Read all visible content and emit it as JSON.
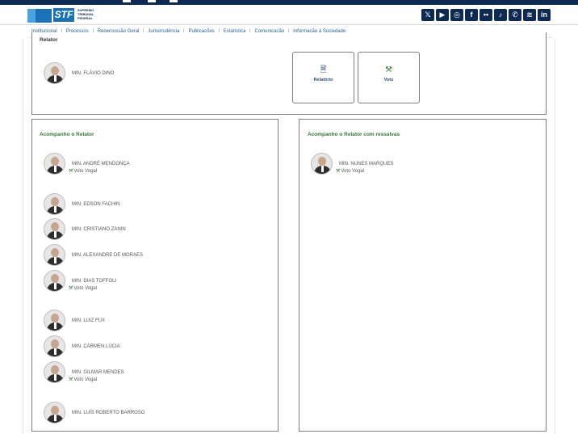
{
  "header": {
    "logo_text": "STF",
    "logo_name": "SUPREMO TRIBUNAL FEDERAL",
    "socials": [
      {
        "icon": "x-twitter-icon",
        "glyph": "𝕏"
      },
      {
        "icon": "youtube-icon",
        "glyph": "▶"
      },
      {
        "icon": "instagram-icon",
        "glyph": "◎"
      },
      {
        "icon": "facebook-icon",
        "glyph": "f"
      },
      {
        "icon": "flickr-icon",
        "glyph": "••"
      },
      {
        "icon": "tiktok-icon",
        "glyph": "♪"
      },
      {
        "icon": "whatsapp-icon",
        "glyph": "✆"
      },
      {
        "icon": "spotify-icon",
        "glyph": "≋"
      },
      {
        "icon": "linkedin-icon",
        "glyph": "in"
      }
    ],
    "brand_color": "#0d2a52"
  },
  "nav": {
    "items": [
      "Institucional",
      "Processos",
      "Repercussão Geral",
      "Jurisprudência",
      "Publicações",
      "Estatística",
      "Comunicação",
      "Informação à Sociedade"
    ]
  },
  "relator": {
    "title": "Relator",
    "minister": "MIN. FLÁVIO DINO",
    "actions": [
      {
        "label": "Relatório",
        "icon": "document-icon",
        "glyph": "🗎"
      },
      {
        "label": "Voto",
        "icon": "gavel-icon",
        "glyph": "⚒"
      }
    ]
  },
  "left_column": {
    "title": "Acompanho o Relator",
    "ministers": [
      {
        "name": "MIN. ANDRÉ MENDONÇA",
        "vote": "Voto Vogal"
      },
      {
        "name": "MIN. EDSON FACHIN",
        "vote": ""
      },
      {
        "name": "MIN. CRISTIANO ZANIN",
        "vote": ""
      },
      {
        "name": "MIN. ALEXANDRE DE MORAES",
        "vote": ""
      },
      {
        "name": "MIN. DIAS TOFFOLI",
        "vote": "Voto Vogal"
      },
      {
        "name": "MIN. LUIZ FUX",
        "vote": ""
      },
      {
        "name": "MIN. CÁRMEN LÚCIA",
        "vote": ""
      },
      {
        "name": "MIN. GILMAR MENDES",
        "vote": "Voto Vogal"
      },
      {
        "name": "MIN. LUÍS ROBERTO BARROSO",
        "vote": ""
      }
    ]
  },
  "right_column": {
    "title": "Acompanho o Relator com ressalvas",
    "ministers": [
      {
        "name": "MIN. NUNES MARQUES",
        "vote": "Voto Vogal"
      }
    ]
  },
  "colors": {
    "accent_green": "#2e7d32",
    "link_blue": "#1f5f99"
  }
}
